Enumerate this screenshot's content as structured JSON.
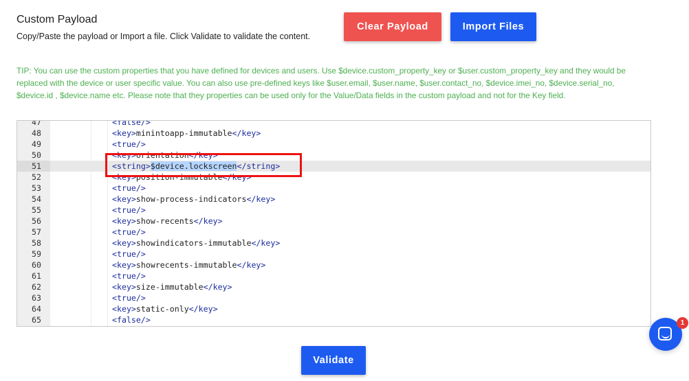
{
  "header": {
    "title": "Custom Payload",
    "subtitle": "Copy/Paste the payload or Import a file. Click Validate to validate the content."
  },
  "buttons": {
    "clear_label": "Clear Payload",
    "import_label": "Import Files",
    "validate_label": "Validate"
  },
  "tip": "TIP: You can use the custom properties that you have defined for devices and users. Use $device.custom_property_key or $user.custom_property_key and they would be replaced with the device or user specific value. You can also use pre-defined keys like $user.email, $user.name, $user.contact_no, $device.imei_no, $device.serial_no, $device.id , $device.name etc. Please note that they properties can be used only for the Value/Data fields in the custom payload and not for the Key field.",
  "editor": {
    "active_line": 51,
    "lines": [
      {
        "n": "47",
        "open": "<false/>",
        "text": "",
        "close": ""
      },
      {
        "n": "48",
        "open": "<key>",
        "text": "minintoapp-immutable",
        "close": "</key>"
      },
      {
        "n": "49",
        "open": "<true/>",
        "text": "",
        "close": ""
      },
      {
        "n": "50",
        "open": "<key>",
        "text": "orientation",
        "close": "</key>"
      },
      {
        "n": "51",
        "open": "<string>",
        "text": "$device.lockscreen",
        "close": "</string>"
      },
      {
        "n": "52",
        "open": "<key>",
        "text": "position-immutable",
        "close": "</key>"
      },
      {
        "n": "53",
        "open": "<true/>",
        "text": "",
        "close": ""
      },
      {
        "n": "54",
        "open": "<key>",
        "text": "show-process-indicators",
        "close": "</key>"
      },
      {
        "n": "55",
        "open": "<true/>",
        "text": "",
        "close": ""
      },
      {
        "n": "56",
        "open": "<key>",
        "text": "show-recents",
        "close": "</key>"
      },
      {
        "n": "57",
        "open": "<true/>",
        "text": "",
        "close": ""
      },
      {
        "n": "58",
        "open": "<key>",
        "text": "showindicators-immutable",
        "close": "</key>"
      },
      {
        "n": "59",
        "open": "<true/>",
        "text": "",
        "close": ""
      },
      {
        "n": "60",
        "open": "<key>",
        "text": "showrecents-immutable",
        "close": "</key>"
      },
      {
        "n": "61",
        "open": "<true/>",
        "text": "",
        "close": ""
      },
      {
        "n": "62",
        "open": "<key>",
        "text": "size-immutable",
        "close": "</key>"
      },
      {
        "n": "63",
        "open": "<true/>",
        "text": "",
        "close": ""
      },
      {
        "n": "64",
        "open": "<key>",
        "text": "static-only",
        "close": "</key>"
      },
      {
        "n": "65",
        "open": "<false/>",
        "text": "",
        "close": ""
      }
    ]
  },
  "chat_widget": {
    "icon": "chat-bubble-icon",
    "badge_count": "1"
  },
  "colors": {
    "clear_button": "#ef5350",
    "primary_button": "#1d5bf0",
    "tip_text": "#4caf50",
    "highlight_box": "#ee1111"
  }
}
